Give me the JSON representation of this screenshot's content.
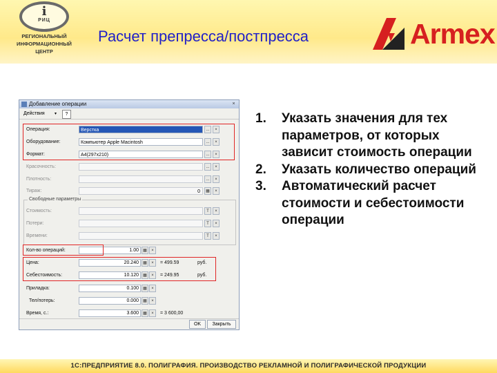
{
  "header": {
    "title": "Расчет препресса/постпресса",
    "logo": {
      "glyph": "i",
      "abbr": "РИЦ",
      "lines": [
        "РЕГИОНАЛЬНЫЙ",
        "ИНФОРМАЦИОННЫЙ",
        "ЦЕНТР"
      ]
    },
    "brand": "Armex"
  },
  "dialog": {
    "title": "Добавление операции",
    "close_glyph": "×",
    "toolbar": {
      "actions_label": "Действия",
      "arrow": "▾",
      "help_label": "?"
    },
    "fields": [
      {
        "label": "Операция:",
        "value": "Верстка",
        "buttons": [
          "...",
          "×"
        ]
      },
      {
        "label": "Оборудование:",
        "value": "Компьютер Apple Macintosh",
        "buttons": [
          "...",
          "×"
        ]
      },
      {
        "label": "Формат:",
        "value": "А4(297х210)",
        "buttons": [
          "...",
          "×"
        ]
      },
      {
        "label": "Красочность:",
        "value": "",
        "buttons": [
          "...",
          "×"
        ]
      },
      {
        "label": "Плотность:",
        "value": "",
        "buttons": [
          "...",
          "×"
        ]
      },
      {
        "label": "Тираж:",
        "value": "0",
        "buttons": [
          "▦",
          "×"
        ]
      }
    ],
    "free_params": {
      "title": "Свободные параметры",
      "fields": [
        {
          "label": "Стоимость:",
          "buttons": [
            "Т",
            "×"
          ]
        },
        {
          "label": "Потери:",
          "buttons": [
            "Т",
            "×"
          ]
        },
        {
          "label": "Времени:",
          "buttons": [
            "Т",
            "×"
          ]
        }
      ]
    },
    "calc": [
      {
        "label": "Кол-во операций:",
        "value": "1.00",
        "result": "",
        "unit": ""
      },
      {
        "label": "Цена:",
        "value": "20.240",
        "result": "= 499.59",
        "unit": "руб."
      },
      {
        "label": "Себестоимость:",
        "value": "10.120",
        "result": "= 249.95",
        "unit": "руб."
      },
      {
        "label": "Приладка:",
        "value": "0.100",
        "result": "",
        "unit": ""
      },
      {
        "label": "Тел/потерь:",
        "value": "0.000",
        "result": "",
        "unit": ""
      },
      {
        "label": "Время, с.:",
        "value": "3.600",
        "result": "= 3 600,00",
        "unit": ""
      }
    ],
    "calc_buttons": [
      "▦",
      "×"
    ],
    "buttons": {
      "ok": "OK",
      "close": "Закрыть"
    }
  },
  "steps": [
    {
      "num": "1.",
      "text": "Указать значения для тех параметров, от которых зависит стоимость операции"
    },
    {
      "num": "2.",
      "text": "Указать количество операций"
    },
    {
      "num": "3.",
      "text": "Автоматический расчет стоимости и себестоимости операции"
    }
  ],
  "footer": {
    "text": "1С:ПРЕДПРИЯТИЕ 8.0. ПОЛИГРАФИЯ. ПРОИЗВОДСТВО РЕКЛАМНОЙ И ПОЛИГРАФИЧЕСКОЙ ПРОДУКЦИИ"
  },
  "colors": {
    "title": "#1f1fc8",
    "brand": "#d62020",
    "highlight": "#e02424",
    "selection": "#2456b6"
  }
}
